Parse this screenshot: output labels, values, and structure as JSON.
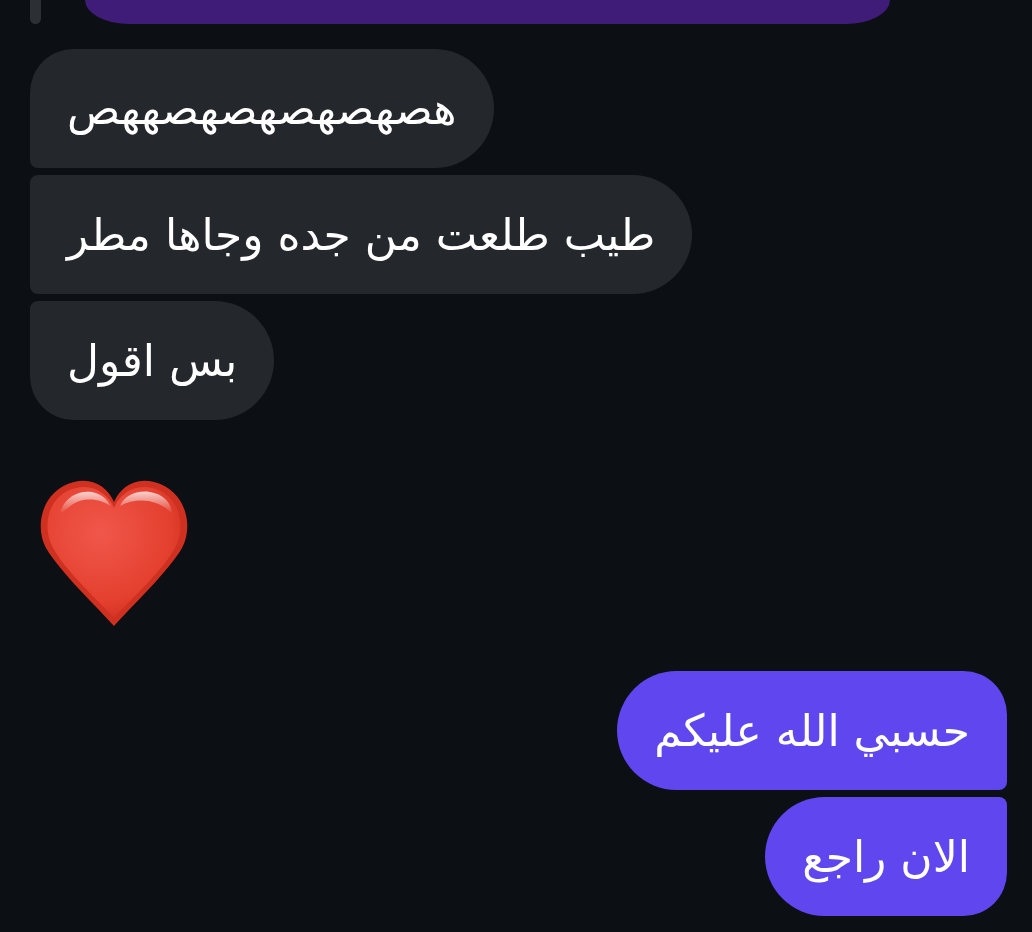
{
  "messages": [
    {
      "kind": "quote",
      "outgoing": true
    },
    {
      "kind": "text",
      "outgoing": false,
      "text": "هصهصهصهصهصههص"
    },
    {
      "kind": "text",
      "outgoing": false,
      "text": "طيب طلعت من جده وجاها مطر"
    },
    {
      "kind": "text",
      "outgoing": false,
      "text": "بس اقول"
    },
    {
      "kind": "heart"
    },
    {
      "kind": "text",
      "outgoing": true,
      "text": "حسبي الله عليكم"
    },
    {
      "kind": "text",
      "outgoing": true,
      "text": "الان راجع"
    }
  ]
}
